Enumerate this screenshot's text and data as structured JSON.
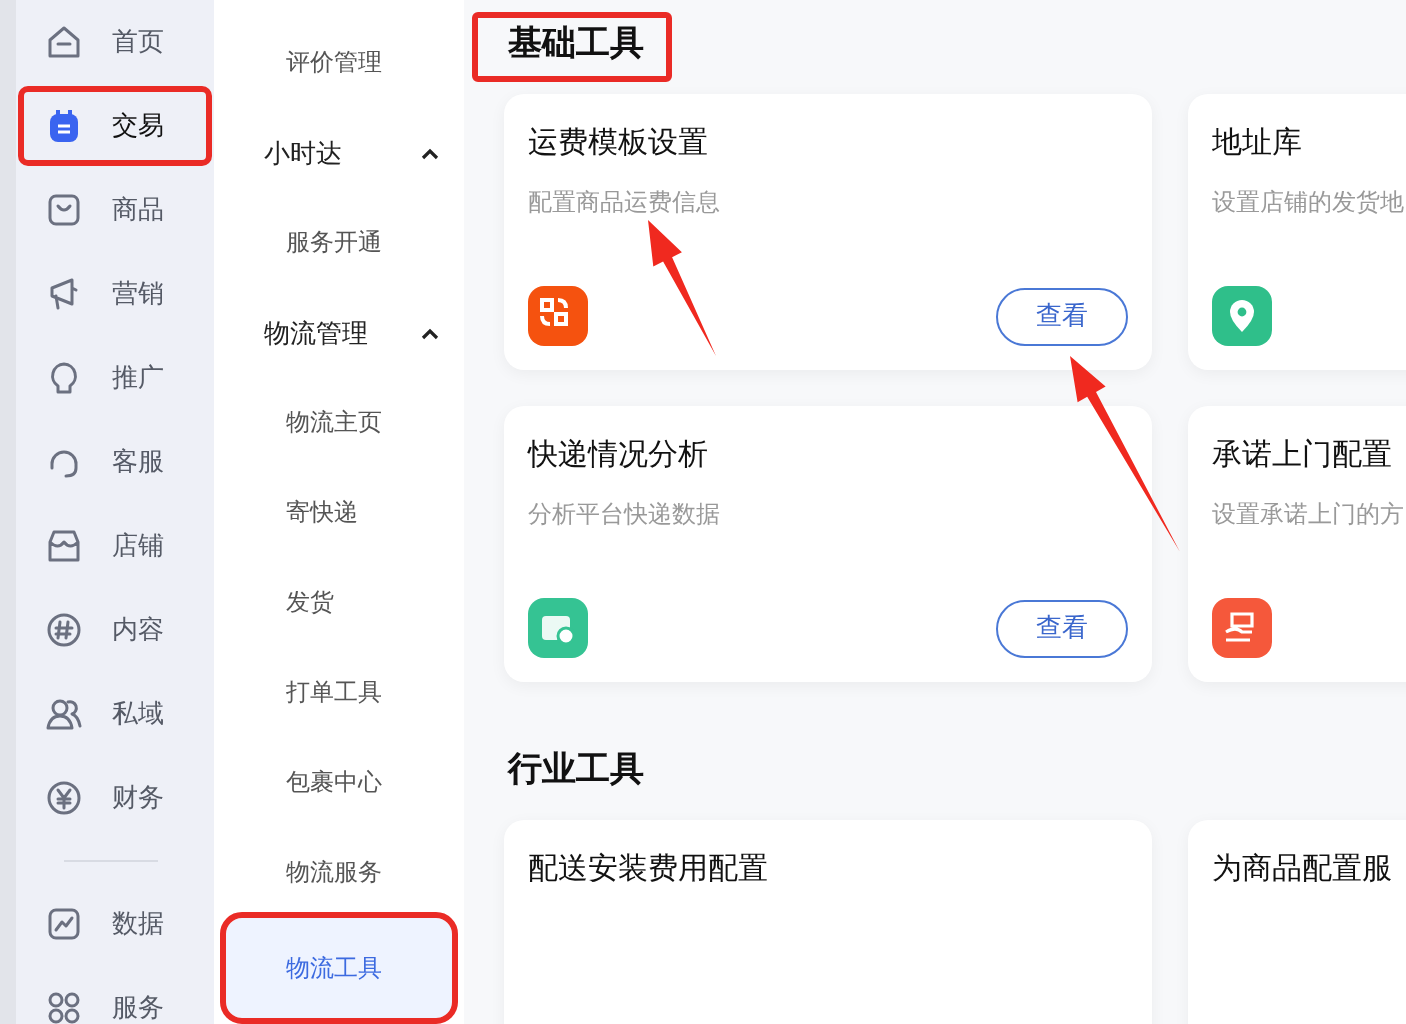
{
  "nav": {
    "sections": [
      [
        {
          "label": "首页",
          "selected": false,
          "highlighted": false
        },
        {
          "label": "交易",
          "selected": true,
          "highlighted": true
        },
        {
          "label": "商品",
          "selected": false,
          "highlighted": false
        },
        {
          "label": "营销",
          "selected": false,
          "highlighted": false
        },
        {
          "label": "推广",
          "selected": false,
          "highlighted": false
        },
        {
          "label": "客服",
          "selected": false,
          "highlighted": false
        },
        {
          "label": "店铺",
          "selected": false,
          "highlighted": false
        },
        {
          "label": "内容",
          "selected": false,
          "highlighted": false
        },
        {
          "label": "私域",
          "selected": false,
          "highlighted": false
        },
        {
          "label": "财务",
          "selected": false,
          "highlighted": false
        }
      ],
      [
        {
          "label": "数据",
          "selected": false,
          "highlighted": false
        },
        {
          "label": "服务",
          "selected": false,
          "highlighted": false
        }
      ]
    ]
  },
  "submenu": [
    {
      "kind": "link",
      "label": "评价管理",
      "selected": false,
      "highlighted": false
    },
    {
      "kind": "group",
      "label": "小时达",
      "expanded": true,
      "children": [
        {
          "label": "服务开通",
          "selected": false,
          "highlighted": false
        }
      ]
    },
    {
      "kind": "group",
      "label": "物流管理",
      "expanded": true,
      "children": [
        {
          "label": "物流主页",
          "selected": false,
          "highlighted": false
        },
        {
          "label": "寄快递",
          "selected": false,
          "highlighted": false
        },
        {
          "label": "发货",
          "selected": false,
          "highlighted": false
        },
        {
          "label": "打单工具",
          "selected": false,
          "highlighted": false
        },
        {
          "label": "包裹中心",
          "selected": false,
          "highlighted": false
        },
        {
          "label": "物流服务",
          "selected": false,
          "highlighted": false
        },
        {
          "label": "物流工具",
          "selected": true,
          "highlighted": true
        }
      ]
    }
  ],
  "sections": [
    {
      "title": "基础工具",
      "highlighted": true,
      "cards": [
        {
          "title": "运费模板设置",
          "description": "配置商品运费信息",
          "color": "#f5520f",
          "button": "查看",
          "title_arrow": true,
          "button_arrow": true
        },
        {
          "title": "地址库",
          "description": "设置店铺的发货地",
          "color": "#2fbf8a"
        },
        {
          "title": "快递情况分析",
          "description": "分析平台快递数据",
          "color": "#35c393",
          "button": "查看"
        },
        {
          "title": "承诺上门配置",
          "description": "设置承诺上门的方",
          "color": "#f5583b"
        }
      ]
    },
    {
      "title": "行业工具",
      "highlighted": false,
      "cards": [
        {
          "title": "配送安装费用配置"
        },
        {
          "title": "为商品配置服"
        }
      ]
    }
  ]
}
